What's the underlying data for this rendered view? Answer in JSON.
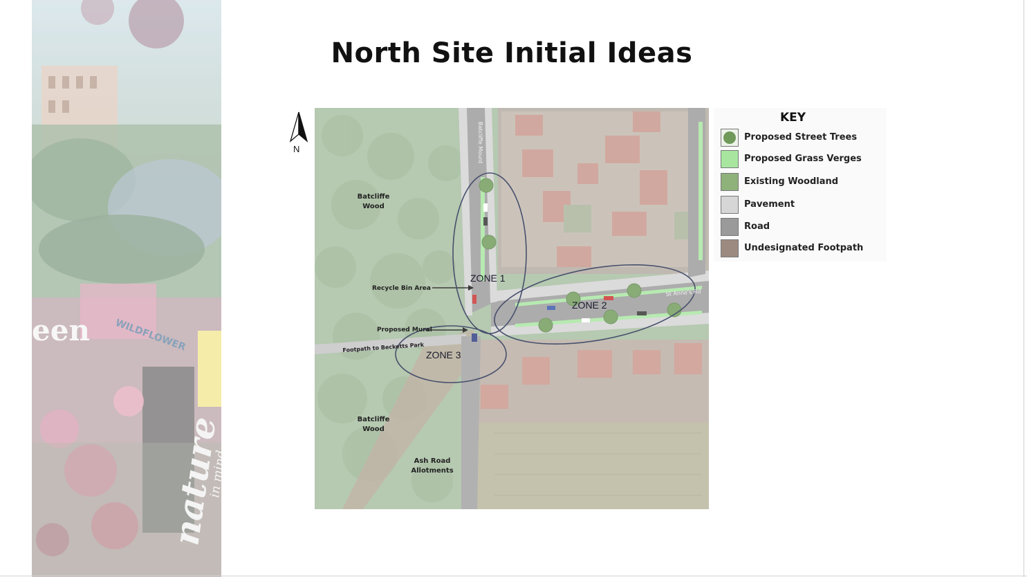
{
  "slide": {
    "title": "North Site Initial Ideas"
  },
  "compass": {
    "label": "N"
  },
  "collage": {
    "words": [
      "een",
      "WILDFLOWER",
      "nature",
      "in mind"
    ]
  },
  "map": {
    "street_labels": {
      "batcliffe_mount": "Batcliffe Mount",
      "st_annes_rd": "St Anne's Rd"
    },
    "wood_north": [
      "Batcliffe",
      "Wood"
    ],
    "wood_south": [
      "Batcliffe",
      "Wood"
    ],
    "allotments": [
      "Ash Road",
      "Allotments"
    ],
    "recycle": "Recycle  Bin Area",
    "mural": "Proposed Mural",
    "footpath": "Footpath to Becketts Park",
    "zones": [
      "ZONE 1",
      "ZONE 2",
      "ZONE 3"
    ]
  },
  "key": {
    "title": "KEY",
    "items": [
      {
        "label": "Proposed Street Trees",
        "color": "#6f9a5a",
        "icon": "tree-swatch"
      },
      {
        "label": "Proposed Grass Verges",
        "color": "#a8e6a0",
        "icon": "verge-swatch"
      },
      {
        "label": "Existing Woodland",
        "color": "#8fb27a",
        "icon": "woodland-swatch"
      },
      {
        "label": "Pavement",
        "color": "#d6d6d6",
        "icon": "pavement-swatch"
      },
      {
        "label": "Road",
        "color": "#9a9a9a",
        "icon": "road-swatch"
      },
      {
        "label": "Undesignated Footpath",
        "color": "#9c8a80",
        "icon": "footpath-swatch"
      }
    ]
  }
}
